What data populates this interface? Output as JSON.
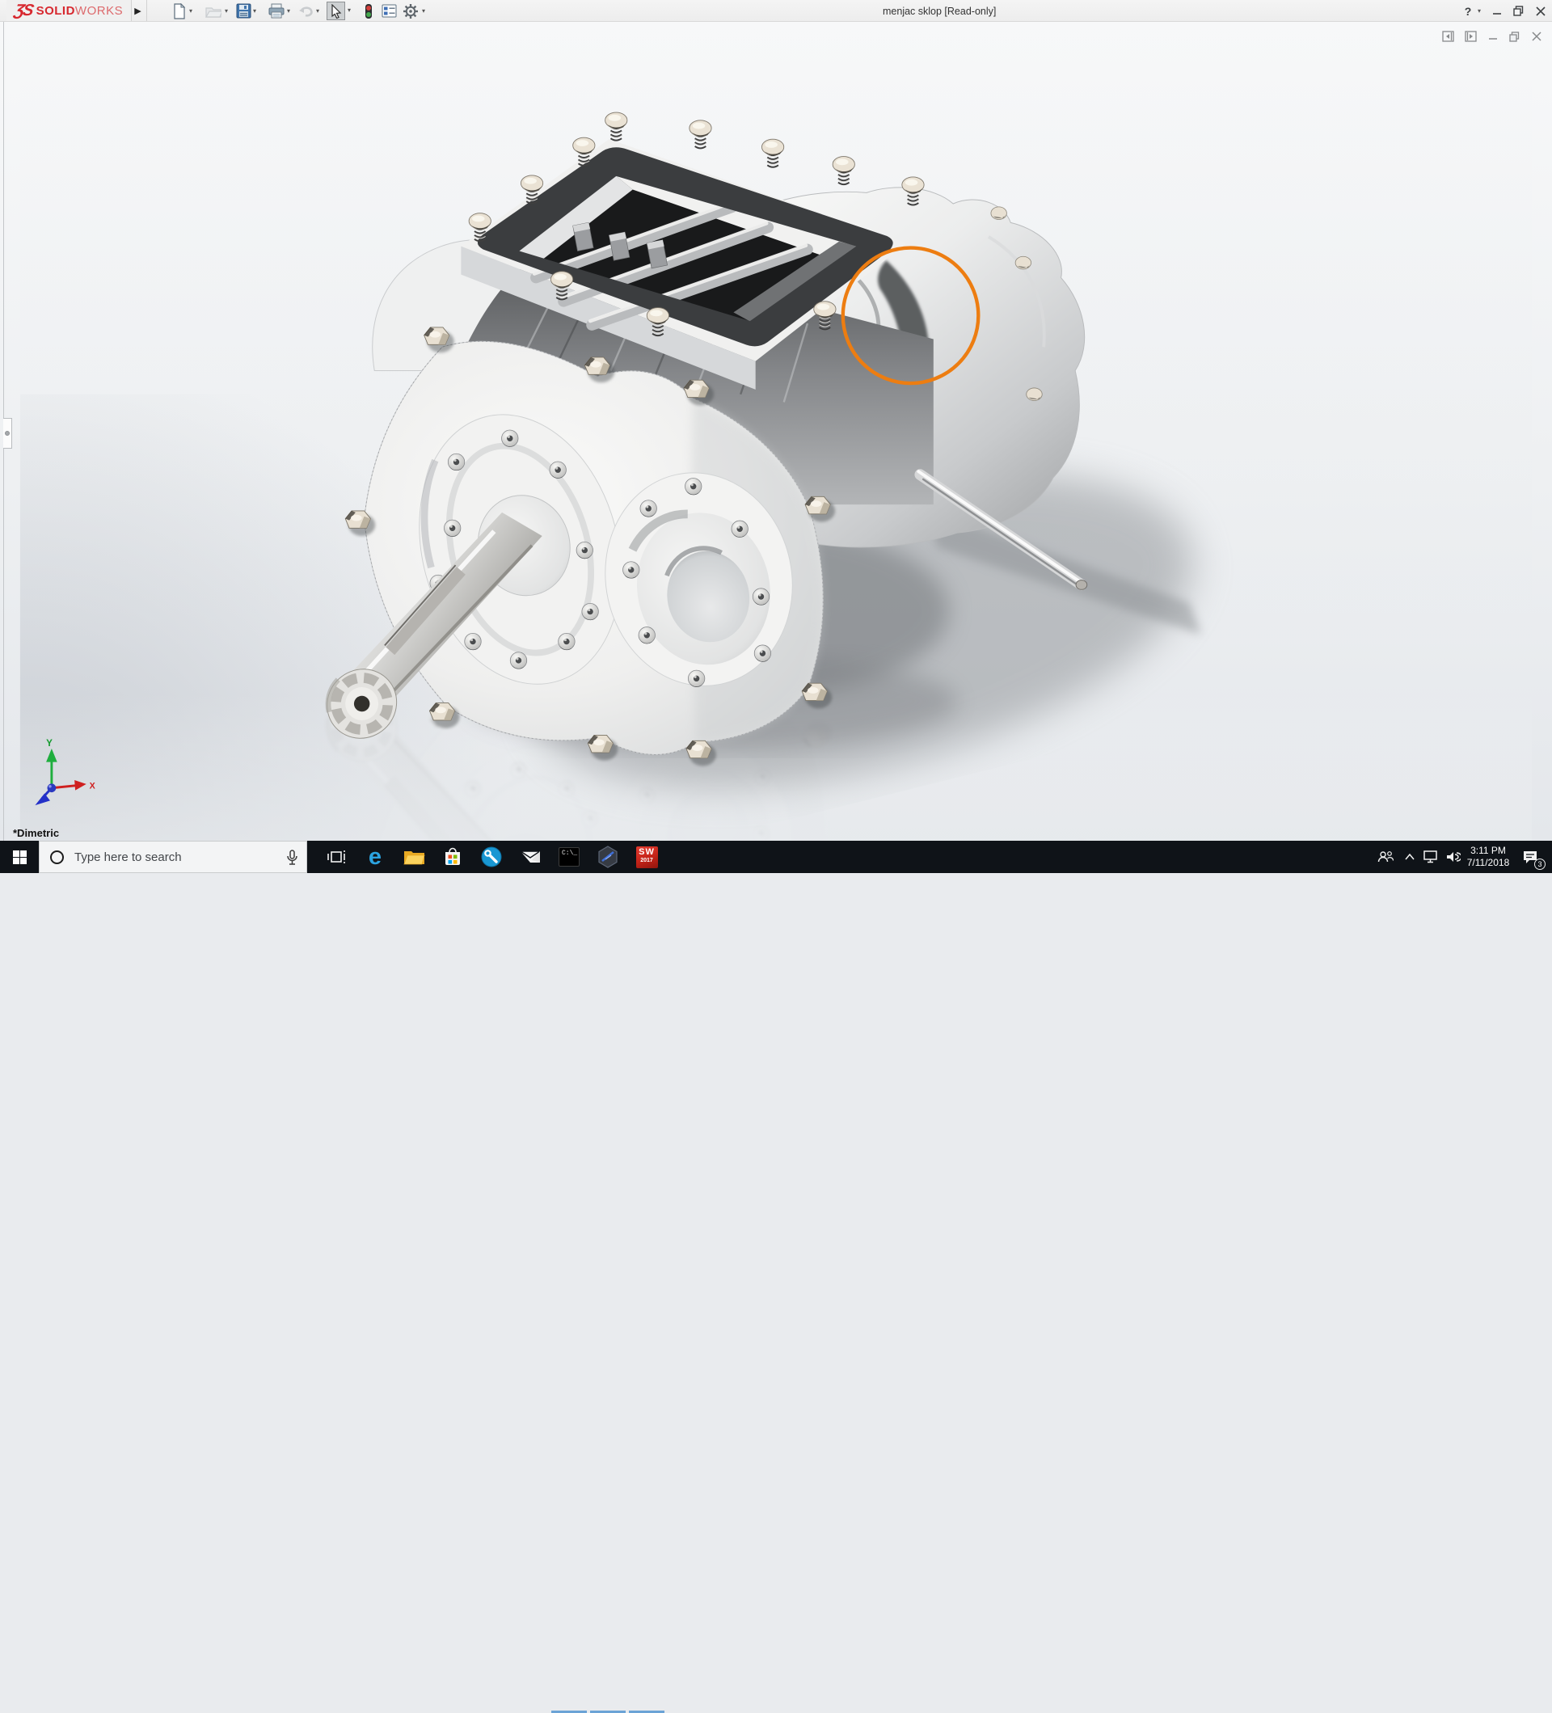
{
  "app": {
    "logo": {
      "mark": "ƷS",
      "brand_bold": "SOLID",
      "brand_light": "WORKS"
    },
    "title": "menjac sklop [Read-only]",
    "help_label": "?"
  },
  "toolbar": {
    "items": [
      {
        "name": "new-document",
        "has_dropdown": true
      },
      {
        "name": "open",
        "has_dropdown": true,
        "disabled": true
      },
      {
        "name": "save",
        "has_dropdown": true
      },
      {
        "name": "print",
        "has_dropdown": true
      },
      {
        "name": "undo",
        "has_dropdown": true,
        "disabled": true
      },
      {
        "name": "select",
        "has_dropdown": true,
        "active": true
      },
      {
        "name": "traffic-light-indicator"
      },
      {
        "name": "list-report"
      },
      {
        "name": "options-gear",
        "has_dropdown": true
      }
    ]
  },
  "window_controls": [
    "help",
    "help-dropdown",
    "minimize",
    "restore",
    "close"
  ],
  "document_controls": [
    "pane-left",
    "pane-right",
    "minimize",
    "restore",
    "close"
  ],
  "viewport": {
    "model_subject": "gearbox assembly 3D model with exploded top cover, spring bolts and splined input shaft",
    "orientation_label": "*Dimetric",
    "triad": {
      "x_label": "X",
      "y_label": "Y"
    },
    "annotation_circle_color": "#ED7D11"
  },
  "taskbar": {
    "search": {
      "placeholder": "Type here to search"
    },
    "app_icons": [
      "task-view",
      "edge",
      "file-explorer",
      "store",
      "wrench-tool-app",
      "mail",
      "command-prompt",
      "hexagon-app",
      "solidworks-2017"
    ],
    "running_apps": [
      "command-prompt",
      "hexagon-app",
      "solidworks-2017"
    ],
    "edge_letter": "e",
    "cmd_icon_text": "C:\\_",
    "sw_icon": {
      "letters": "SW",
      "year": "2017"
    },
    "tray": {
      "icons": [
        "people",
        "chevron-up",
        "network",
        "volume",
        "action-center"
      ],
      "time": "3:11 PM",
      "date": "7/11/2018",
      "notification_badge": "3"
    }
  },
  "colors": {
    "solidworks_red": "#d7282f",
    "accent_orange": "#ED7D11",
    "taskbar_bg": "#0f1318",
    "running_underline": "#6ba3d6",
    "search_bg": "#f3f4f5"
  }
}
